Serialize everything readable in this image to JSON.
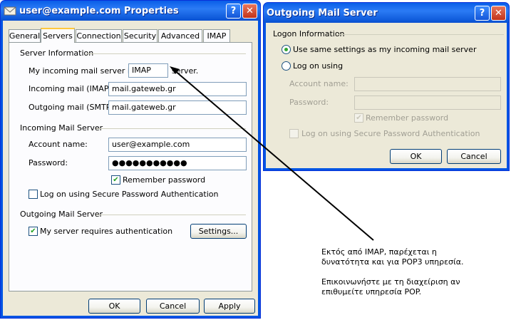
{
  "props_window": {
    "title": "user@example.com Properties",
    "help_glyph": "?",
    "close_glyph": "✕",
    "tabs": [
      "General",
      "Servers",
      "Connection",
      "Security",
      "Advanced",
      "IMAP"
    ],
    "server_info": {
      "group_title": "Server Information",
      "type_prefix": "My incoming mail server is a",
      "type_value": "IMAP",
      "type_suffix": "server.",
      "incoming_label": "Incoming mail (IMAP):",
      "incoming_value": "mail.gateweb.gr",
      "outgoing_label": "Outgoing mail (SMTP):",
      "outgoing_value": "mail.gateweb.gr"
    },
    "incoming_server": {
      "group_title": "Incoming Mail Server",
      "account_label": "Account name:",
      "account_value": "user@example.com",
      "password_label": "Password:",
      "password_value": "●●●●●●●●●●●",
      "remember_label": "Remember password",
      "remember_checked": true,
      "spa_label": "Log on using Secure Password Authentication",
      "spa_checked": false
    },
    "outgoing_server": {
      "group_title": "Outgoing Mail Server",
      "auth_label": "My server requires authentication",
      "auth_checked": true,
      "settings_button": "Settings..."
    },
    "buttons": {
      "ok": "OK",
      "cancel": "Cancel",
      "apply": "Apply"
    }
  },
  "outgoing_window": {
    "title": "Outgoing Mail Server",
    "help_glyph": "?",
    "close_glyph": "✕",
    "group_title": "Logon Information",
    "radio_same": "Use same settings as my incoming mail server",
    "radio_same_selected": true,
    "radio_logon": "Log on using",
    "account_label": "Account name:",
    "account_value": "",
    "password_label": "Password:",
    "password_value": "",
    "remember_label": "Remember password",
    "remember_checked": true,
    "spa_label": "Log on using Secure Password Authentication",
    "spa_checked": false,
    "buttons": {
      "ok": "OK",
      "cancel": "Cancel"
    }
  },
  "annotation": {
    "line1": "Εκτός από IMAP, παρέχεται η",
    "line2": "δυνατότητα και για POP3 υπηρεσία.",
    "line3": "Επικοινωνήστε με τη διαχείριση αν",
    "line4": "επιθυμείτε υπηρεσία POP."
  },
  "icons": {
    "envelope": "envelope-icon",
    "check": "✔"
  }
}
